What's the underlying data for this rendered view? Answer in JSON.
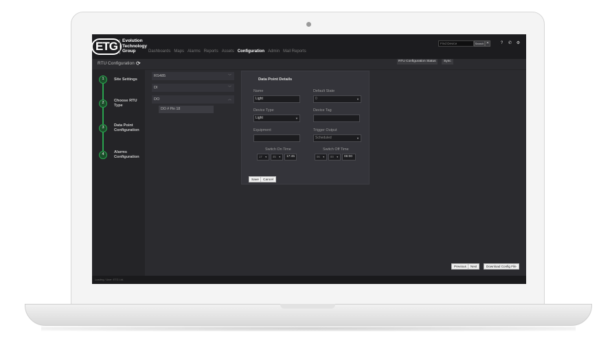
{
  "brand": {
    "logo": "ETG",
    "line1": "Evolution",
    "line2": "Technology",
    "line3": "Group"
  },
  "nav": {
    "items": [
      "Dashboards",
      "Maps",
      "Alarms",
      "Reports",
      "Assets",
      "Configuration",
      "Admin",
      "Mail Reports"
    ],
    "active": "Configuration"
  },
  "header": {
    "find_placeholder": "Find Device",
    "search_label": "Search",
    "extra_icon": "clear-icon",
    "help_icon": "?",
    "phone_icon": "✆",
    "gear_icon": "⚙"
  },
  "subbar": {
    "title": "RTU Configuration",
    "status_label": "RTU Configuration Status",
    "sync_label": "Sync"
  },
  "steps": [
    {
      "num": "1",
      "label": "Site Settings"
    },
    {
      "num": "2",
      "label": "Choose RTU Type"
    },
    {
      "num": "3",
      "label": "Data Point Configuration"
    },
    {
      "num": "4",
      "label": "Alarms Configuration"
    }
  ],
  "accordion": {
    "rs485": "RS485",
    "di": "DI",
    "do": "DO",
    "do_item": "DO # Pin 18"
  },
  "details": {
    "title": "Data Point Details",
    "name_label": "Name",
    "name_value": "Light",
    "default_state_label": "Default State",
    "default_state_value": "0",
    "device_type_label": "Device Type",
    "device_type_value": "Light",
    "device_tag_label": "Device Tag",
    "device_tag_value": "",
    "equipment_label": "Equipment",
    "equipment_value": "",
    "trigger_output_label": "Trigger Output",
    "trigger_output_value": "Scheduled",
    "switch_on_label": "Switch On Time",
    "switch_on_hour": "17",
    "switch_on_min": "45",
    "switch_on_value": "17:45",
    "switch_off_label": "Switch Off Time",
    "switch_off_hour": "06",
    "switch_off_min": "00",
    "switch_off_value": "06:00",
    "save_label": "Save",
    "cancel_label": "Cancel"
  },
  "footer": {
    "previous_label": "Previous",
    "next_label": "Next",
    "download_label": "Download Config File"
  },
  "statusbar": {
    "text": "Loading / User: ETG Ltd."
  }
}
